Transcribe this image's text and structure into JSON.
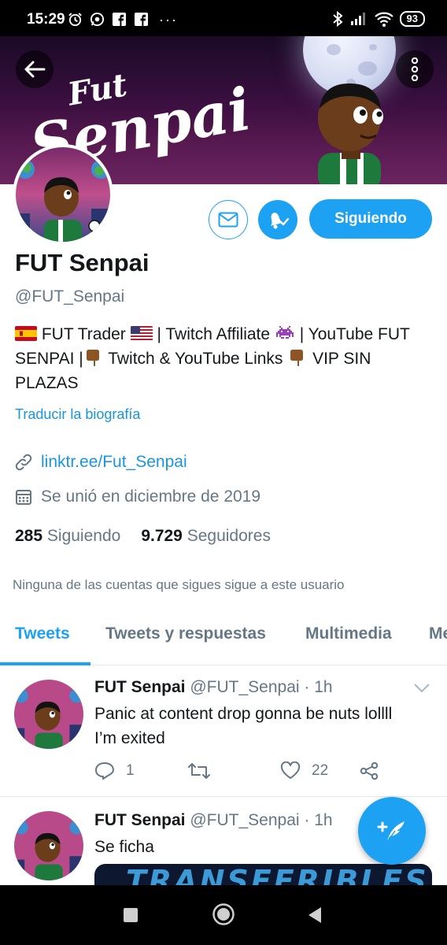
{
  "status_bar": {
    "time": "15:29",
    "more": "···",
    "battery": "93"
  },
  "banner": {
    "title_line1": "Fut",
    "title_line2": "Senpai"
  },
  "actions": {
    "follow_label": "Siguiendo"
  },
  "profile": {
    "name": "FUT Senpai",
    "handle": "@FUT_Senpai",
    "bio_parts": {
      "p1": " FUT Trader ",
      "p2": " | Twitch Affiliate ",
      "p3": " | YouTube FUT SENPAI |",
      "p4": " Twitch & YouTube Links ",
      "p5": " VIP SIN PLAZAS"
    },
    "translate_label": "Traducir la biografía",
    "link": "linktr.ee/Fut_Senpai",
    "joined": "Se unió en diciembre de 2019",
    "following_count": "285",
    "following_label": "Siguiendo",
    "followers_count": "9.729",
    "followers_label": "Seguidores",
    "mutual_notice": "Ninguna de las cuentas que sigues sigue a este usuario"
  },
  "tabs": [
    {
      "label": "Tweets",
      "active": true
    },
    {
      "label": "Tweets y respuestas",
      "active": false
    },
    {
      "label": "Multimedia",
      "active": false
    },
    {
      "label": "Me",
      "active": false
    }
  ],
  "tweets": [
    {
      "name": "FUT Senpai",
      "meta": "@FUT_Senpai · 1h",
      "text": "Panic at content drop gonna be nuts lollll I’m exited",
      "replies": "1",
      "retweets": "",
      "likes": "22"
    },
    {
      "name": "FUT Senpai",
      "meta": "@FUT_Senpai · 1h",
      "text": "Se ficha",
      "media_text": "TRANSFERIBLES"
    }
  ],
  "colors": {
    "accent": "#1da1f2",
    "link": "#1b95e0",
    "secondary_text": "#657786"
  }
}
